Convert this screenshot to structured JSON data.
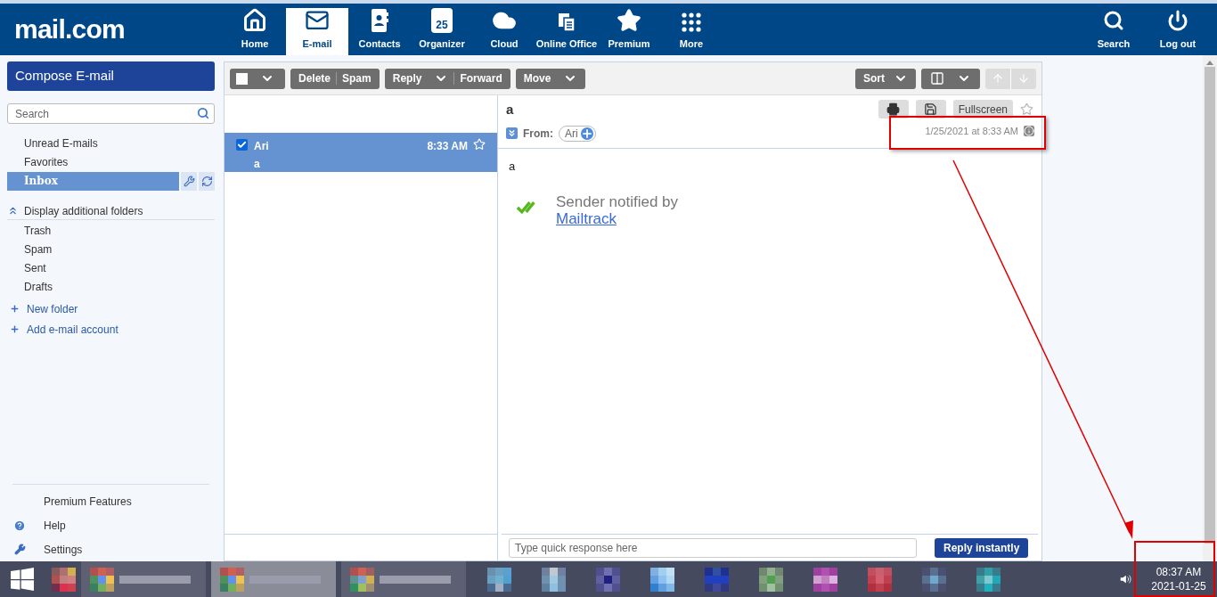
{
  "header": {
    "logo": "mail.com",
    "nav": [
      {
        "label": "Home",
        "selected": false
      },
      {
        "label": "E-mail",
        "selected": true
      },
      {
        "label": "Contacts",
        "selected": false
      },
      {
        "label": "Organizer",
        "selected": false,
        "calendar_day": "25"
      },
      {
        "label": "Cloud",
        "selected": false
      },
      {
        "label": "Online Office",
        "selected": false
      },
      {
        "label": "Premium",
        "selected": false
      },
      {
        "label": "More",
        "selected": false
      }
    ],
    "actions": [
      "Search",
      "Log out"
    ]
  },
  "sidebar": {
    "compose": "Compose E-mail",
    "search": {
      "placeholder": "Search"
    },
    "quick_folders": [
      {
        "label": "Unread E-mails",
        "selected": false
      },
      {
        "label": "Favorites",
        "selected": false
      },
      {
        "label": "Inbox",
        "selected": true
      }
    ],
    "toggle": "Display additional folders",
    "folders": [
      {
        "label": "Trash"
      },
      {
        "label": "Spam"
      },
      {
        "label": "Sent"
      },
      {
        "label": "Drafts"
      }
    ],
    "add_links": [
      "New folder",
      "Add e-mail account"
    ],
    "footer": [
      "Premium Features",
      "Help",
      "Settings"
    ]
  },
  "toolbar": {
    "select_all": {
      "checked": false
    },
    "groups": [
      [
        "Delete",
        "Spam"
      ],
      [
        "Reply",
        "Forward"
      ],
      [
        "Move"
      ]
    ],
    "sort": "Sort"
  },
  "messages": [
    {
      "sender": "Ari",
      "subject": "a",
      "time": "8:33 AM",
      "checked": true,
      "selected": true,
      "starred": false
    }
  ],
  "reader": {
    "subject": "a",
    "from_label": "From:",
    "from": "Ari",
    "fullscreen": "Fullscreen",
    "date": "1/25/2021 at 8:33 AM",
    "body": "a",
    "notice": "Sender notified by",
    "notice_link": "Mailtrack",
    "quick_reply": {
      "placeholder": "Type quick response here"
    },
    "reply_button": "Reply instantly"
  },
  "taskbar": {
    "time": "08:37 AM",
    "date": "2021-01-25"
  }
}
